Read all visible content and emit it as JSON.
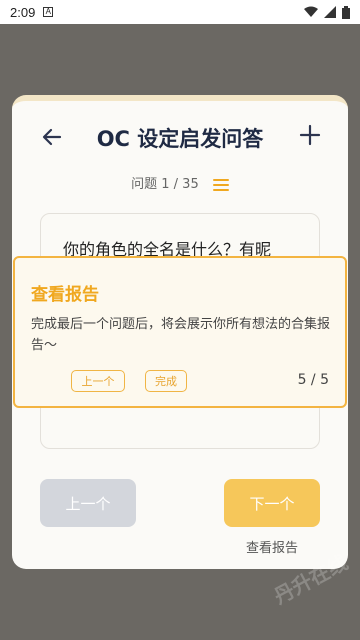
{
  "status_bar": {
    "time": "2:09",
    "sim_label": "A"
  },
  "header": {
    "title": "OC 设定启发问答"
  },
  "progress": {
    "text": "问题 1 / 35"
  },
  "question": {
    "text": "你的角色的全名是什么？有昵"
  },
  "nav": {
    "prev_label": "上一个",
    "next_label": "下一个",
    "report_label": "查看报告"
  },
  "tooltip": {
    "title": "查看报告",
    "body": "完成最后一个问题后，将会展示你所有想法的合集报告～",
    "prev_label": "上一个",
    "done_label": "完成",
    "counter": "5 / 5"
  },
  "watermark": {
    "text": "丹升在线"
  },
  "colors": {
    "accent": "#f3b441",
    "title_color": "#1f2a44",
    "next_button": "#f6c75a",
    "prev_button": "#d3d6dc"
  },
  "icons": [
    "back-arrow-icon",
    "plus-icon",
    "menu-icon",
    "wifi-icon",
    "signal-icon",
    "battery-icon"
  ]
}
